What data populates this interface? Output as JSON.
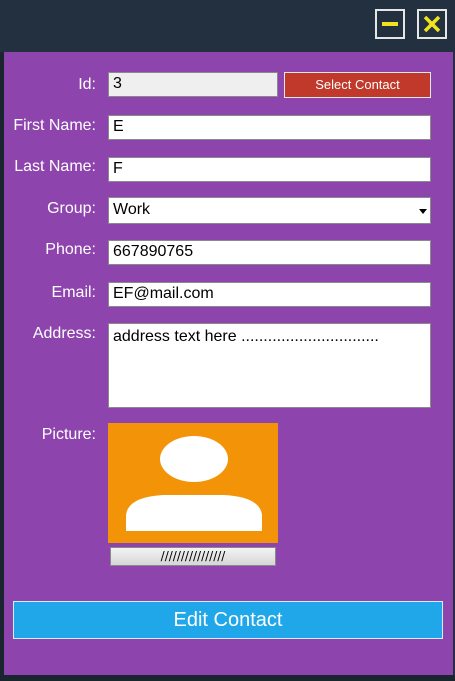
{
  "window": {
    "minimize_icon": "minimize-icon",
    "close_icon": "close-icon",
    "accent": "#f3e21f"
  },
  "form": {
    "id": {
      "label": "Id:",
      "value": "3"
    },
    "select_contact_label": "Select Contact",
    "first_name": {
      "label": "First Name:",
      "value": "E"
    },
    "last_name": {
      "label": "Last Name:",
      "value": "F"
    },
    "group": {
      "label": "Group:",
      "value": "Work"
    },
    "phone": {
      "label": "Phone:",
      "value": "667890765"
    },
    "email": {
      "label": "Email:",
      "value": "EF@mail.com"
    },
    "address": {
      "label": "Address:",
      "value": "address text here ..............................."
    },
    "picture": {
      "label": "Picture:",
      "icon": "user-avatar-icon"
    },
    "browse_label": "////////////////",
    "edit_contact_label": "Edit Contact"
  },
  "colors": {
    "panel": "#8e44ad",
    "select_button": "#c0392b",
    "picture_background": "#f39307",
    "edit_button": "#1fa7ea"
  }
}
